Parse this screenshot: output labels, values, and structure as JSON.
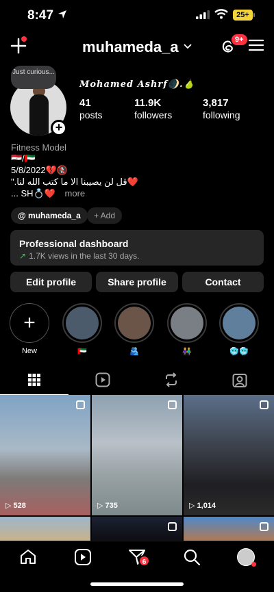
{
  "status": {
    "time": "8:47",
    "battery": "25+"
  },
  "header": {
    "username": "muhameda_a",
    "notification_badge": "9+"
  },
  "profile": {
    "note": "Just curious...",
    "display_name": "Mohamed Ashrf🌒.🍐",
    "stats": [
      {
        "value": "41",
        "label": "posts"
      },
      {
        "value": "11.9K",
        "label": "followers"
      },
      {
        "value": "3,817",
        "label": "following"
      }
    ],
    "category": "Fitness Model",
    "bio": [
      "🇪🇬/🇦🇪",
      "5/8/2022💔🚷",
      "\".قل لن يصيبنا الا ما كتب الله لنا❤️",
      "... SH💍❤️"
    ],
    "more": "more",
    "threads_chip": "muhameda_a",
    "add_chip": "+ Add"
  },
  "dashboard": {
    "title": "Professional dashboard",
    "subtitle": "1.7K views in the last 30 days."
  },
  "buttons": [
    "Edit profile",
    "Share profile",
    "Contact"
  ],
  "highlights": [
    {
      "caption": "New"
    },
    {
      "caption": "🇦🇪",
      "color": "#4b5b6c"
    },
    {
      "caption": "🫂",
      "color": "#6a5548"
    },
    {
      "caption": "👫",
      "color": "#7a7f86"
    },
    {
      "caption": "🥶🥶",
      "color": "#5f7f9c"
    }
  ],
  "posts": [
    {
      "views": "528",
      "colors": [
        "#7fa3c5",
        "#a86060"
      ]
    },
    {
      "views": "735",
      "colors": [
        "#b9c1c8",
        "#7d8a8c"
      ]
    },
    {
      "views": "1,014",
      "colors": [
        "#5c6f8a",
        "#2b2b2b"
      ]
    },
    {
      "views": "",
      "colors": [
        "#9cb6cc",
        "#c9b28a"
      ]
    },
    {
      "views": "",
      "colors": [
        "#1c2233",
        "#0d0d12"
      ]
    },
    {
      "views": "",
      "colors": [
        "#4f88c9",
        "#b07a55"
      ]
    }
  ],
  "nav_badge": "6"
}
